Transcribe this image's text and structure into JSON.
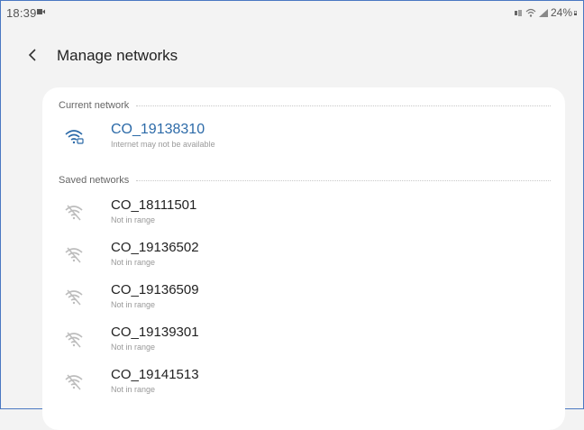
{
  "status_bar": {
    "time": "18:39",
    "battery": "24%"
  },
  "header": {
    "title": "Manage networks"
  },
  "current_section": {
    "label": "Current network",
    "network": {
      "name": "CO_19138310",
      "status": "Internet may not be available",
      "icon": "wifi-connected-warning-icon"
    }
  },
  "saved_section": {
    "label": "Saved networks",
    "networks": [
      {
        "name": "CO_18111501",
        "status": "Not in range",
        "icon": "wifi-off-icon"
      },
      {
        "name": "CO_19136502",
        "status": "Not in range",
        "icon": "wifi-off-icon"
      },
      {
        "name": "CO_19136509",
        "status": "Not in range",
        "icon": "wifi-off-icon"
      },
      {
        "name": "CO_19139301",
        "status": "Not in range",
        "icon": "wifi-off-icon"
      },
      {
        "name": "CO_19141513",
        "status": "Not in range",
        "icon": "wifi-off-icon"
      }
    ]
  },
  "colors": {
    "accent": "#2c6aa8",
    "background": "#f3f3f3",
    "card": "#ffffff"
  }
}
